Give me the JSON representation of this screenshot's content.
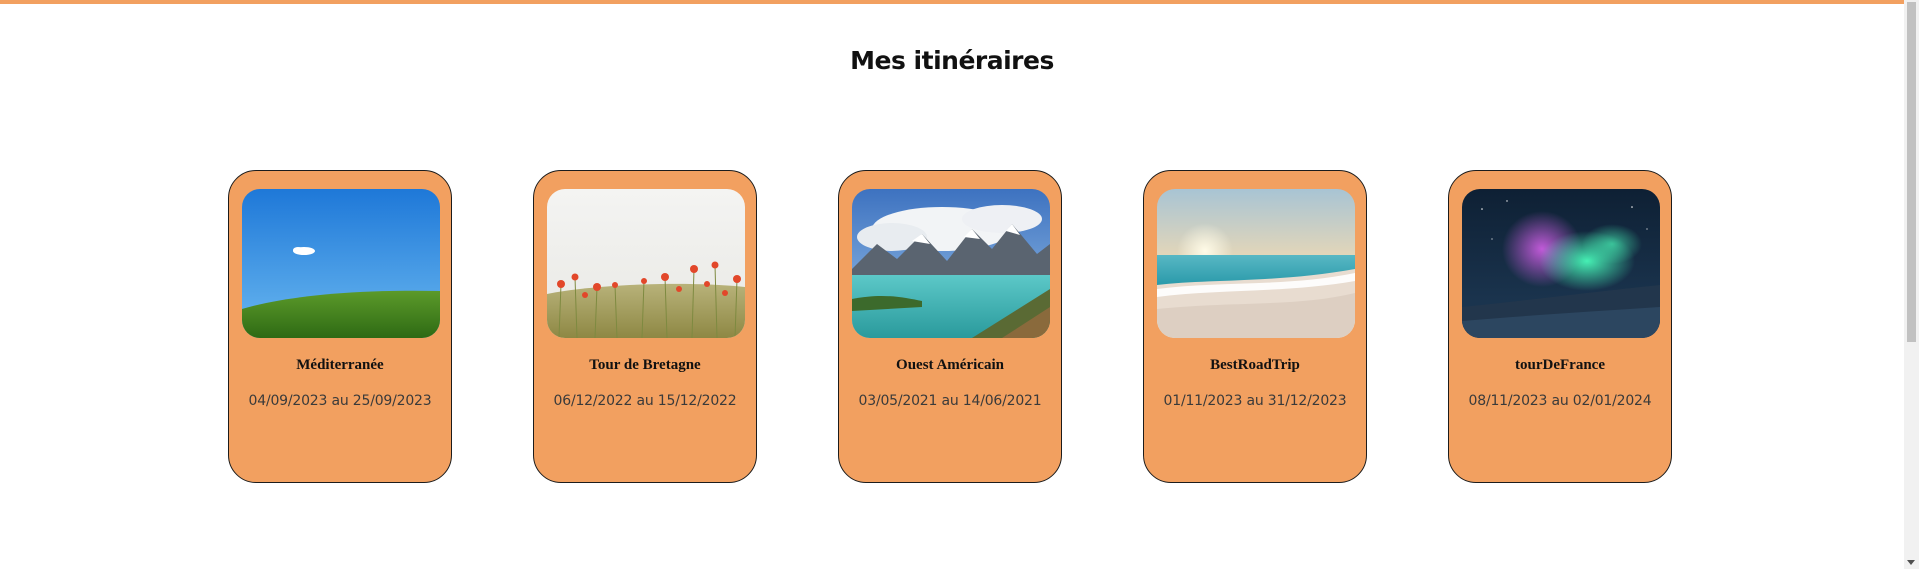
{
  "page": {
    "title": "Mes itinéraires",
    "accent_color": "#f2a060"
  },
  "itineraries": [
    {
      "name": "Méditerranée",
      "dates": "04/09/2023 au 25/09/2023",
      "image": "green-hill-blue-sky"
    },
    {
      "name": "Tour de Bretagne",
      "dates": "06/12/2022 au 15/12/2022",
      "image": "poppy-field"
    },
    {
      "name": "Ouest Américain",
      "dates": "03/05/2021 au 14/06/2021",
      "image": "mountain-lake"
    },
    {
      "name": "BestRoadTrip",
      "dates": "01/11/2023 au 31/12/2023",
      "image": "beach-sunset"
    },
    {
      "name": "tourDeFrance",
      "dates": "08/11/2023 au 02/01/2024",
      "image": "aurora-borealis"
    }
  ]
}
